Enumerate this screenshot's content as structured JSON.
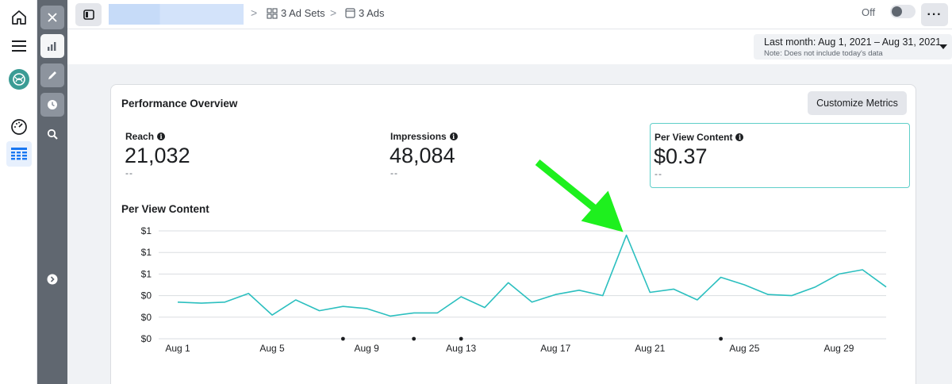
{
  "rail": {
    "icons": [
      "home-icon",
      "menu-icon",
      "account-logo-icon",
      "speedometer-icon",
      "table-icon"
    ]
  },
  "strip": {
    "icons": [
      "close-icon",
      "bar-chart-icon",
      "pencil-icon",
      "clock-icon",
      "search-icon",
      "expand-arrow-icon"
    ]
  },
  "topbar": {
    "crumb_adsets": "3 Ad Sets",
    "crumb_ads": "3 Ads",
    "status_label": "Off",
    "more_label": "···"
  },
  "daterange": {
    "label": "Last month: Aug 1, 2021 – Aug 31, 2021",
    "note": "Note: Does not include today's data"
  },
  "card": {
    "title": "Performance Overview",
    "customize_label": "Customize Metrics",
    "metrics": [
      {
        "label": "Reach",
        "value": "21,032",
        "delta": "--"
      },
      {
        "label": "Impressions",
        "value": "48,084",
        "delta": "--"
      },
      {
        "label": "Per View Content",
        "value": "$0.37",
        "delta": "--"
      }
    ]
  },
  "colors": {
    "line": "#2bbfbf",
    "selected_border": "#5fcfc9",
    "annotation_arrow": "#1ef01e"
  },
  "chart_data": {
    "type": "line",
    "title": "Per View Content",
    "x": [
      "Aug 1",
      "Aug 2",
      "Aug 3",
      "Aug 4",
      "Aug 5",
      "Aug 6",
      "Aug 7",
      "Aug 8",
      "Aug 9",
      "Aug 10",
      "Aug 11",
      "Aug 12",
      "Aug 13",
      "Aug 14",
      "Aug 15",
      "Aug 16",
      "Aug 17",
      "Aug 18",
      "Aug 19",
      "Aug 20",
      "Aug 21",
      "Aug 22",
      "Aug 23",
      "Aug 24",
      "Aug 25",
      "Aug 26",
      "Aug 27",
      "Aug 28",
      "Aug 29",
      "Aug 30",
      "Aug 31"
    ],
    "xticks": [
      "Aug 1",
      "Aug 5",
      "Aug 9",
      "Aug 13",
      "Aug 17",
      "Aug 21",
      "Aug 25",
      "Aug 29"
    ],
    "yticks": [
      "$0",
      "$0",
      "$0",
      "$1",
      "$1",
      "$1"
    ],
    "ylim": [
      0,
      1.0
    ],
    "series": [
      {
        "values": [
          0.34,
          0.33,
          0.34,
          0.42,
          0.22,
          0.36,
          0.26,
          0.3,
          0.28,
          0.21,
          0.24,
          0.24,
          0.39,
          0.29,
          0.52,
          0.34,
          0.41,
          0.45,
          0.4,
          0.96,
          0.43,
          0.46,
          0.36,
          0.57,
          0.5,
          0.41,
          0.4,
          0.48,
          0.6,
          0.64,
          0.48
        ]
      }
    ],
    "markers": [
      "Aug 8",
      "Aug 11",
      "Aug 13",
      "Aug 24"
    ],
    "grid": true,
    "legend": "none"
  }
}
